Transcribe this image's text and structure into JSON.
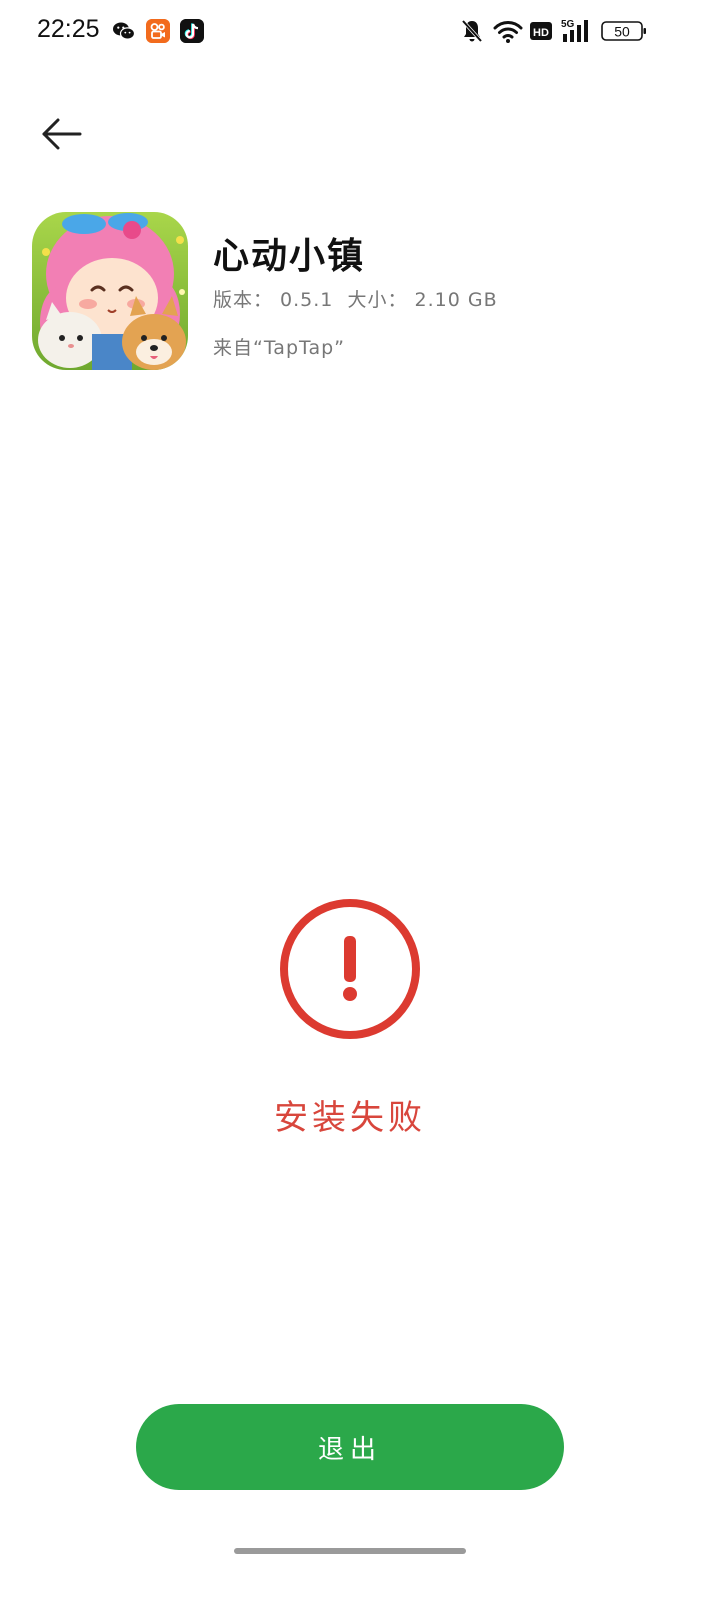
{
  "status_bar": {
    "time": "22:25",
    "battery": "50",
    "network": "5G",
    "hd_badge": "HD",
    "left_icons": [
      "wechat-icon",
      "kuaishou-icon",
      "douyin-icon"
    ],
    "right_icons": [
      "bell-off-icon",
      "wifi-icon",
      "hd-icon",
      "signal-5g-icon",
      "battery-icon"
    ]
  },
  "nav": {
    "back_icon": "arrow-left-icon"
  },
  "app": {
    "name": "心动小镇",
    "version_line": "版本： 0.5.1  大小： 2.10 GB",
    "source_line": "来自“TapTap”"
  },
  "result": {
    "status_text": "安装失败",
    "status_icon": "error-circle-icon",
    "color": "#d8463c"
  },
  "actions": {
    "exit_label": "退出",
    "exit_color": "#2ba84a"
  }
}
